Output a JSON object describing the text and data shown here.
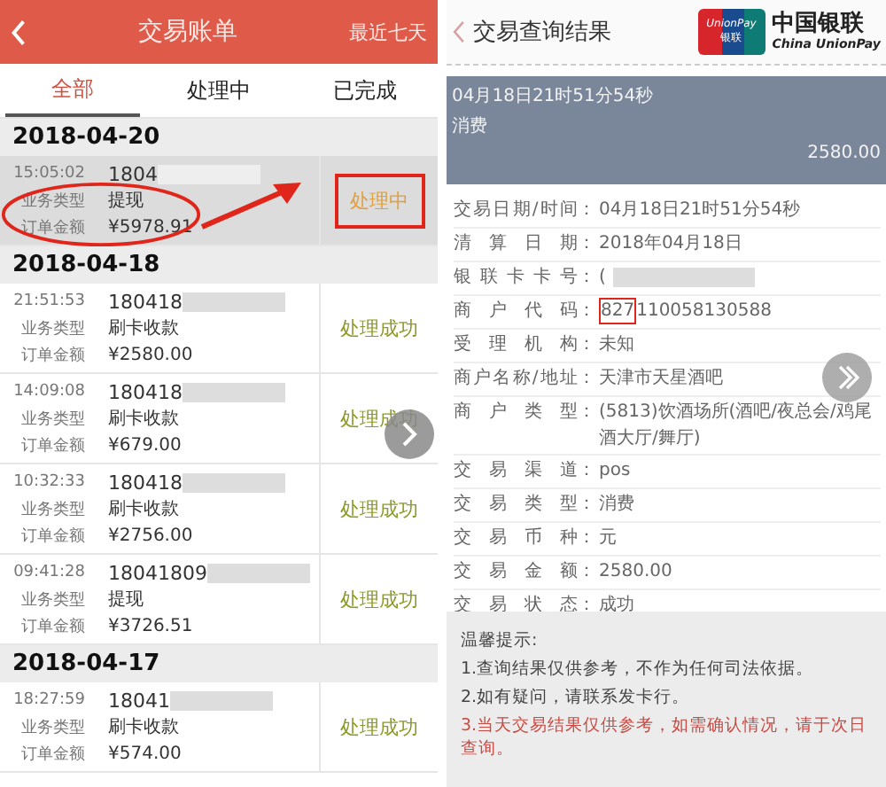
{
  "left": {
    "header": {
      "title": "交易账单",
      "action": "最近七天"
    },
    "tabs": [
      {
        "label": "全部",
        "selected": true
      },
      {
        "label": "处理中",
        "selected": false
      },
      {
        "label": "已完成",
        "selected": false
      }
    ],
    "groups": [
      {
        "date": "2018-04-20",
        "entries": [
          {
            "time": "15:05:02",
            "order_no": "1804",
            "type_label": "业务类型",
            "type": "提现",
            "amount_label": "订单金额",
            "amount": "¥5978.91",
            "status": "处理中",
            "kind": "pending",
            "selected": true,
            "circled": true
          }
        ]
      },
      {
        "date": "2018-04-18",
        "entries": [
          {
            "time": "21:51:53",
            "order_no": "180418",
            "type_label": "业务类型",
            "type": "刷卡收款",
            "amount_label": "订单金额",
            "amount": "¥2580.00",
            "status": "处理成功",
            "kind": "success",
            "selected": false,
            "circled": false
          },
          {
            "time": "14:09:08",
            "order_no": "180418",
            "type_label": "业务类型",
            "type": "刷卡收款",
            "amount_label": "订单金额",
            "amount": "¥679.00",
            "status": "处理成功",
            "kind": "success",
            "selected": false,
            "circled": false
          },
          {
            "time": "10:32:33",
            "order_no": "180418",
            "type_label": "业务类型",
            "type": "刷卡收款",
            "amount_label": "订单金额",
            "amount": "¥2756.00",
            "status": "处理成功",
            "kind": "success",
            "selected": false,
            "circled": false
          },
          {
            "time": "09:41:28",
            "order_no": "18041809",
            "type_label": "业务类型",
            "type": "提现",
            "amount_label": "订单金额",
            "amount": "¥3726.51",
            "status": "处理成功",
            "kind": "success",
            "selected": false,
            "circled": false
          }
        ]
      },
      {
        "date": "2018-04-17",
        "entries": [
          {
            "time": "18:27:59",
            "order_no": "18041",
            "type_label": "业务类型",
            "type": "刷卡收款",
            "amount_label": "订单金额",
            "amount": "¥574.00",
            "status": "处理成功",
            "kind": "success",
            "selected": false,
            "circled": false
          }
        ]
      }
    ]
  },
  "right": {
    "header": {
      "title": "交易查询结果",
      "logo_en": "UnionPay",
      "logo_cn": "银联",
      "brand_cn": "中国银联",
      "brand_en": "China UnionPay"
    },
    "summary": {
      "datetime": "04月18日21时51分54秒",
      "type": "消费",
      "amount": "2580.00"
    },
    "details": [
      {
        "label": "交易日期/时间",
        "colon": "：",
        "value": "04月18日21时51分54秒",
        "blurred": false
      },
      {
        "label": "清算日期",
        "colon": "：",
        "value": "2018年04月18日",
        "blurred": false
      },
      {
        "label": "银联卡卡号",
        "colon": "：",
        "value": "(",
        "blurred": true
      },
      {
        "label": "商户代码",
        "colon": "：",
        "boxed": "827",
        "value": "110058130588",
        "blurred": false
      },
      {
        "label": "受理机构",
        "colon": "：",
        "value": "未知",
        "blurred": false
      },
      {
        "label": "商户名称/地址",
        "colon": "：",
        "value": "天津市天星酒吧",
        "blurred": false
      },
      {
        "label": "商户类型",
        "colon": "：",
        "value": "(5813)饮酒场所(酒吧/夜总会/鸡尾酒大厅/舞厅)",
        "blurred": false
      },
      {
        "label": "交易渠道",
        "colon": "：",
        "value": "pos",
        "blurred": false
      },
      {
        "label": "交易类型",
        "colon": "：",
        "value": "消费",
        "blurred": false
      },
      {
        "label": "交易币种",
        "colon": "：",
        "value": "元",
        "blurred": false
      },
      {
        "label": "交易金额",
        "colon": "：",
        "value": "2580.00",
        "blurred": false
      },
      {
        "label": "交易状态",
        "colon": "：",
        "value": "成功",
        "blurred": false
      }
    ],
    "notice": {
      "title": "温馨提示:",
      "lines": [
        {
          "text": "1.查询结果仅供参考，不作为任何司法依据。",
          "kind": "normal"
        },
        {
          "text": "2.如有疑问，请联系发卡行。",
          "kind": "normal"
        },
        {
          "text": "3.当天交易结果仅供参考，如需确认情况，请于次日查询。",
          "kind": "warning"
        }
      ]
    }
  }
}
